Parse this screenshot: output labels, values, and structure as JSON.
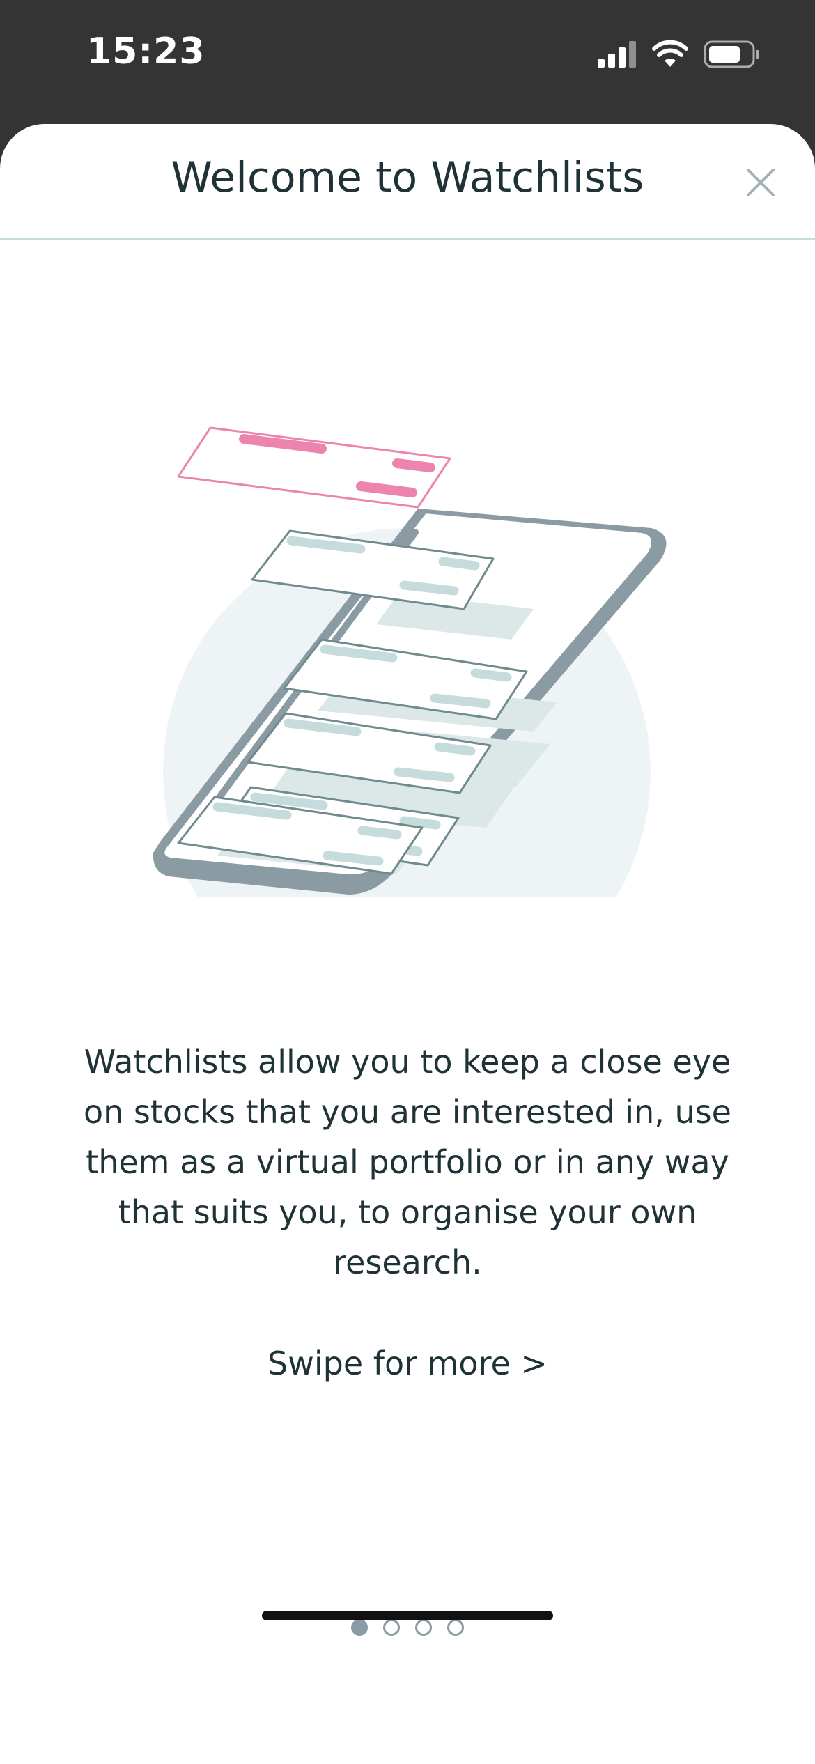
{
  "status_bar": {
    "time": "15:23"
  },
  "header": {
    "title": "Welcome to Watchlists"
  },
  "content": {
    "description": "Watchlists allow you to keep a close eye on stocks that you are interested in, use them as a virtual portfolio or in any way that suits you, to organise your own research.",
    "swipe_hint": "Swipe for more >"
  },
  "pager": {
    "total": 4,
    "active_index": 0
  },
  "colors": {
    "text": "#1f3337",
    "accent_pink": "#ec84ae",
    "card_stroke": "#6f8b8d",
    "phone_body": "#8a9ba3",
    "bg_circle": "#eef4f5"
  },
  "icons": {
    "close": "close-icon",
    "signal": "signal-icon",
    "wifi": "wifi-icon",
    "battery": "battery-icon"
  }
}
